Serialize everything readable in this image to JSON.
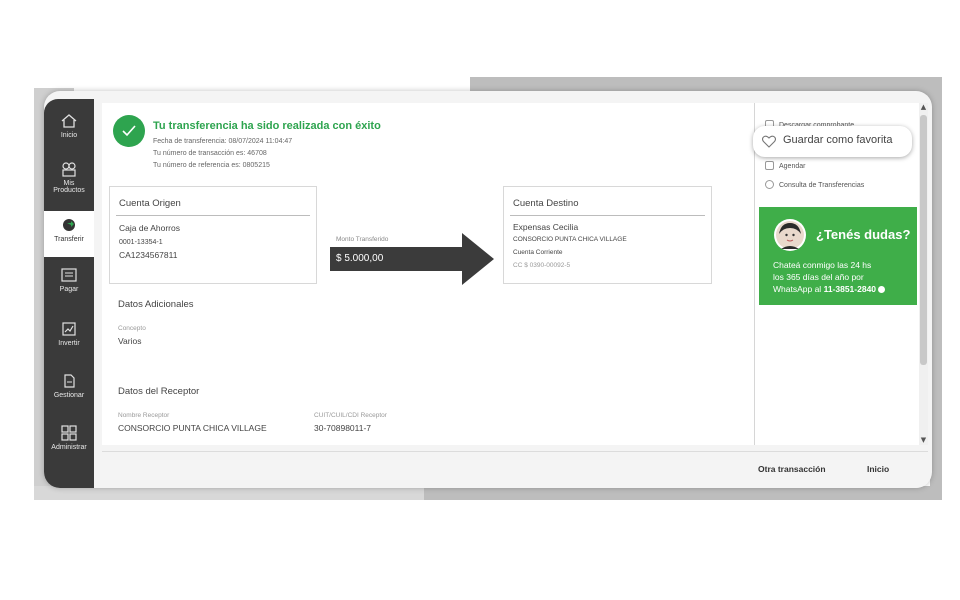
{
  "sidebar": {
    "items": [
      {
        "label": "Inicio",
        "icon": "home-icon"
      },
      {
        "label": "Mis",
        "label2": "Productos",
        "icon": "products-icon"
      },
      {
        "label": "Transferir",
        "icon": "transfer-icon"
      },
      {
        "label": "Pagar",
        "icon": "pay-icon"
      },
      {
        "label": "Invertir",
        "icon": "invest-icon"
      },
      {
        "label": "Gestionar",
        "icon": "manage-icon"
      },
      {
        "label": "Administrar",
        "icon": "admin-icon"
      }
    ]
  },
  "success": {
    "title": "Tu transferencia ha sido realizada con éxito",
    "fecha": "Fecha de transferencia: 08/07/2024 11:04:47",
    "transaccion": "Tu número de transacción es: 46708",
    "referencia": "Tu número de referencia es: 0805215"
  },
  "origen": {
    "title": "Cuenta Origen",
    "tipo": "Caja de Ahorros",
    "numero": "0001-13354-1",
    "cuenta": "CA1234567811"
  },
  "monto": {
    "label": "Monto Transferido",
    "value": "$ 5.000,00"
  },
  "destino": {
    "title": "Cuenta Destino",
    "nombre": "Expensas Cecilia",
    "titular": "CONSORCIO PUNTA CHICA VILLAGE",
    "tipo": "Cuenta Corriente",
    "numero": "CC $ 0390-00092-5"
  },
  "adicionales": {
    "title": "Datos Adicionales",
    "concepto_label": "Concepto",
    "concepto_value": "Varios"
  },
  "receptor": {
    "title": "Datos del Receptor",
    "nombre_label": "Nombre Receptor",
    "nombre_value": "CONSORCIO PUNTA CHICA VILLAGE",
    "cuit_label": "CUIT/CUIL/CDI Receptor",
    "cuit_value": "30-70898011-7"
  },
  "right_panel": {
    "descargar": "Descargar comprobante",
    "agendar": "Agendar",
    "consulta": "Consulta de Transferencias",
    "favorita": "Guardar como favorita"
  },
  "help": {
    "title": "¿Tenés dudas?",
    "line1": "Chateá conmigo las 24 hs",
    "line2": "los 365 días del año por",
    "line3_prefix": "WhatsApp al ",
    "phone": "11-3851-2840"
  },
  "footer": {
    "otra": "Otra transacción",
    "inicio": "Inicio"
  },
  "colors": {
    "brand_green": "#2ea44f",
    "help_green": "#3fae49",
    "sidebar": "#3a3a3a",
    "arrow": "#3b3b3b"
  }
}
